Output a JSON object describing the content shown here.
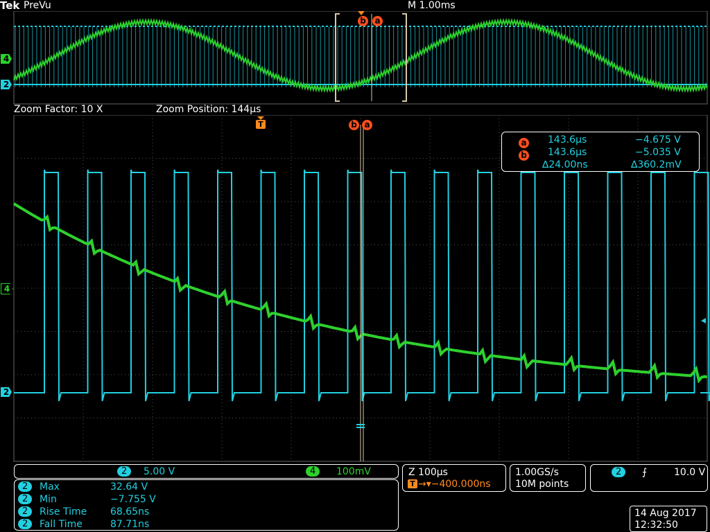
{
  "header": {
    "brand": "Tek",
    "mode": "PreVu",
    "timebase": "M 1.00ms"
  },
  "zoom_bar": {
    "factor": "Zoom Factor: 10 X",
    "position": "Zoom Position: 144µs"
  },
  "channel_markers": {
    "ch4": "4",
    "ch2": "2"
  },
  "cursor_labels": {
    "a": "a",
    "b": "b",
    "trigger": "T"
  },
  "cursor_readout": {
    "a_time": "143.6µs",
    "a_value": "−4.675 V",
    "b_time": "143.6µs",
    "b_value": "−5.035 V",
    "delta_time": "∆24.00ns",
    "delta_value": "∆360.2mV"
  },
  "bottom": {
    "ch2_scale": "5.00 V",
    "ch4_scale": "100mV",
    "zoom_time": "Z 100µs",
    "trigger_pos": "→▾−400.000ns",
    "sample_rate": "1.00GS/s",
    "record_length": "10M points",
    "trigger_level": "10.0 V",
    "trigger_symbol": "⨍"
  },
  "measurements": [
    {
      "channel": "2",
      "name": "Max",
      "value": "32.64 V"
    },
    {
      "channel": "2",
      "name": "Min",
      "value": "−7.755 V"
    },
    {
      "channel": "2",
      "name": "Rise Time",
      "value": "68.65ns"
    },
    {
      "channel": "2",
      "name": "Fall Time",
      "value": "87.71ns"
    }
  ],
  "datetime": {
    "date": "14 Aug 2017",
    "time": "12:32:50"
  },
  "colors": {
    "ch2": "#22d0e0",
    "ch4": "#2ed12e",
    "cursor": "#ff4f1e",
    "trigger": "#ff8a1e",
    "grid": "#555555"
  }
}
